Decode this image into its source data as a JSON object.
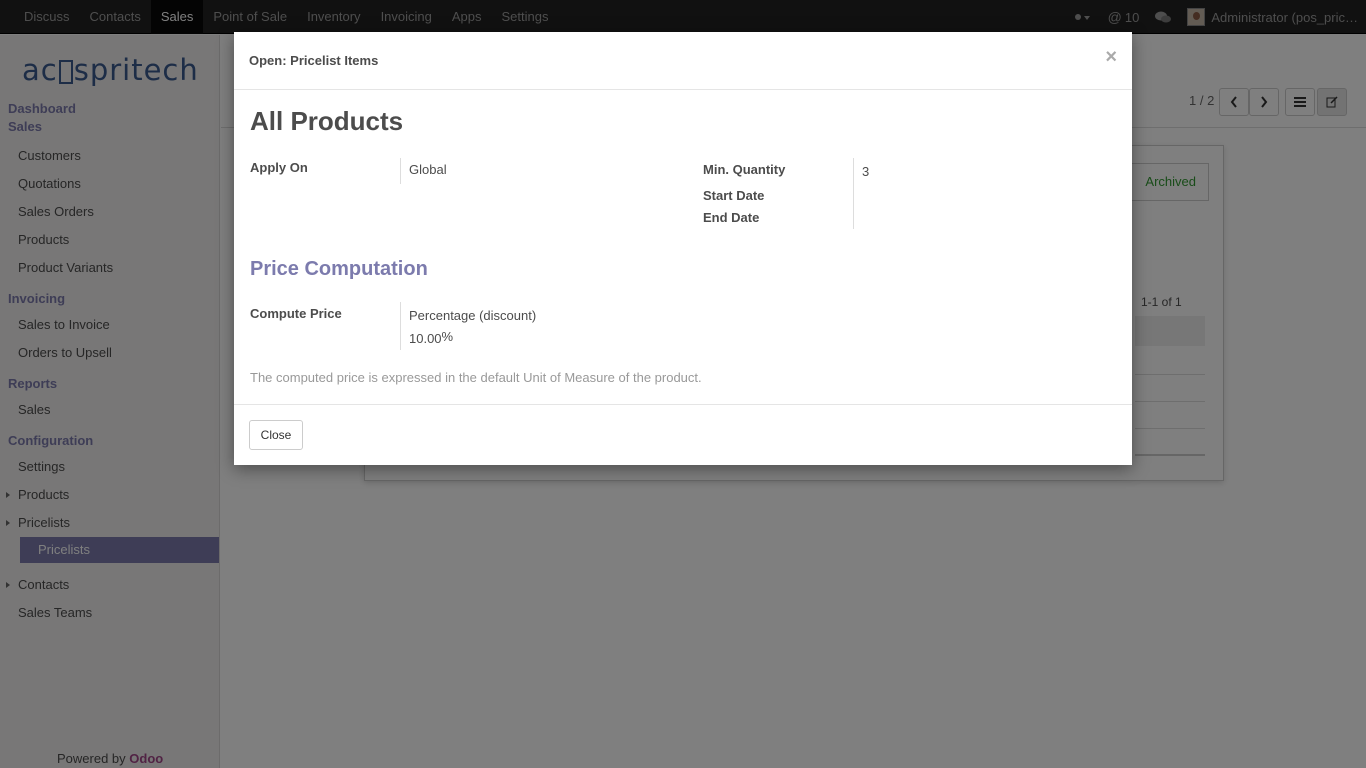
{
  "topbar": {
    "menu": [
      "Discuss",
      "Contacts",
      "Sales",
      "Point of Sale",
      "Inventory",
      "Invoicing",
      "Apps",
      "Settings"
    ],
    "active": "Sales",
    "notification_count": "10",
    "user_label": "Administrator (pos_pric…"
  },
  "sidebar": {
    "logo_text_left": "ac",
    "logo_text_right": "spritech",
    "sections": {
      "dashboard": "Dashboard",
      "sales": "Sales",
      "sales_items": [
        "Customers",
        "Quotations",
        "Sales Orders",
        "Products",
        "Product Variants"
      ],
      "invoicing": "Invoicing",
      "invoicing_items": [
        "Sales to Invoice",
        "Orders to Upsell"
      ],
      "reports": "Reports",
      "reports_items": [
        "Sales"
      ],
      "configuration": "Configuration",
      "config_settings": "Settings",
      "config_products": "Products",
      "config_pricelists": "Pricelists",
      "config_pricelists_sub": "Pricelists",
      "config_contacts": "Contacts",
      "config_sales_teams": "Sales Teams"
    },
    "powered_by": "Powered by",
    "powered_brand": "Odoo"
  },
  "background": {
    "pager": "1 / 2",
    "archived_label": "Archived",
    "record_count": "1-1 of 1"
  },
  "modal": {
    "title": "Open: Pricelist Items",
    "close_symbol": "×",
    "record_name": "All Products",
    "apply_on_label": "Apply On",
    "apply_on_value": "Global",
    "min_qty_label": "Min. Quantity",
    "min_qty_value": "3",
    "start_date_label": "Start Date",
    "end_date_label": "End Date",
    "section_title": "Price Computation",
    "compute_price_label": "Compute Price",
    "compute_price_value": "Percentage (discount)",
    "percent_value": "10.00",
    "percent_suffix": "%",
    "help_text": "The computed price is expressed in the default Unit of Measure of the product.",
    "close_button": "Close"
  }
}
